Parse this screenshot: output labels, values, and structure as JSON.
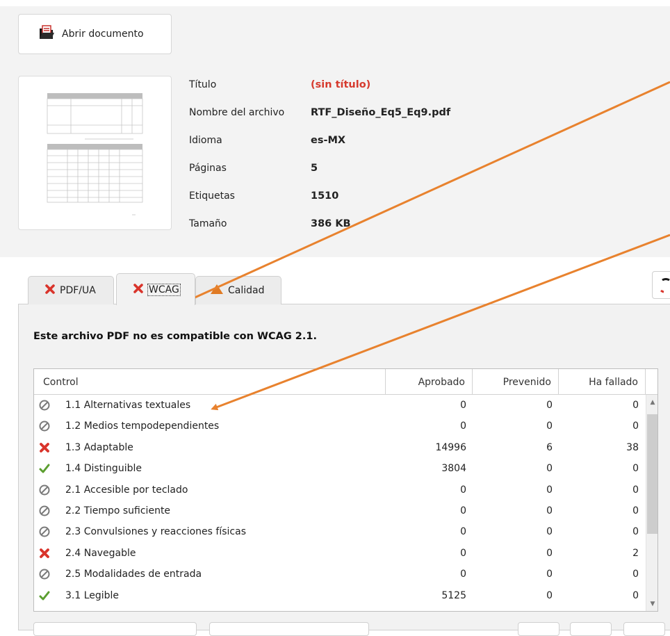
{
  "toolbar": {
    "open_label": "Abrir documento"
  },
  "document": {
    "fields": [
      {
        "key": "Título",
        "value": "(sin título)",
        "highlight": true
      },
      {
        "key": "Nombre del archivo",
        "value": "RTF_Diseño_Eq5_Eq9.pdf",
        "highlight": false
      },
      {
        "key": "Idioma",
        "value": "es-MX",
        "highlight": false
      },
      {
        "key": "Páginas",
        "value": "5",
        "highlight": false
      },
      {
        "key": "Etiquetas",
        "value": "1510",
        "highlight": false
      },
      {
        "key": "Tamaño",
        "value": "386 KB",
        "highlight": false
      }
    ]
  },
  "tabs": [
    {
      "label": "PDF/UA",
      "status": "fail"
    },
    {
      "label": "WCAG",
      "status": "fail",
      "active": true
    },
    {
      "label": "Calidad",
      "status": "warning"
    }
  ],
  "wcag": {
    "message": "Este archivo PDF no es compatible con WCAG 2.1.",
    "columns": {
      "control": "Control",
      "passed": "Aprobado",
      "warned": "Prevenido",
      "failed": "Ha fallado"
    },
    "rows": [
      {
        "status": "na",
        "name": "1.1 Alternativas textuales",
        "passed": "0",
        "warned": "0",
        "failed": "0"
      },
      {
        "status": "na",
        "name": "1.2 Medios tempodependientes",
        "passed": "0",
        "warned": "0",
        "failed": "0"
      },
      {
        "status": "fail",
        "name": "1.3 Adaptable",
        "passed": "14996",
        "warned": "6",
        "failed": "38"
      },
      {
        "status": "pass",
        "name": "1.4 Distinguible",
        "passed": "3804",
        "warned": "0",
        "failed": "0"
      },
      {
        "status": "na",
        "name": "2.1 Accesible por teclado",
        "passed": "0",
        "warned": "0",
        "failed": "0"
      },
      {
        "status": "na",
        "name": "2.2 Tiempo suficiente",
        "passed": "0",
        "warned": "0",
        "failed": "0"
      },
      {
        "status": "na",
        "name": "2.3 Convulsiones y reacciones físicas",
        "passed": "0",
        "warned": "0",
        "failed": "0"
      },
      {
        "status": "fail",
        "name": "2.4 Navegable",
        "passed": "0",
        "warned": "0",
        "failed": "2"
      },
      {
        "status": "na",
        "name": "2.5 Modalidades de entrada",
        "passed": "0",
        "warned": "0",
        "failed": "0"
      },
      {
        "status": "pass",
        "name": "3.1 Legible",
        "passed": "5125",
        "warned": "0",
        "failed": "0"
      }
    ]
  },
  "colors": {
    "fail": "#d9342b",
    "pass": "#5b9e2f",
    "warning": "#e07b24",
    "na": "#7a7a7a",
    "annotation": "#e8822e",
    "title_missing": "#d63a2e"
  }
}
